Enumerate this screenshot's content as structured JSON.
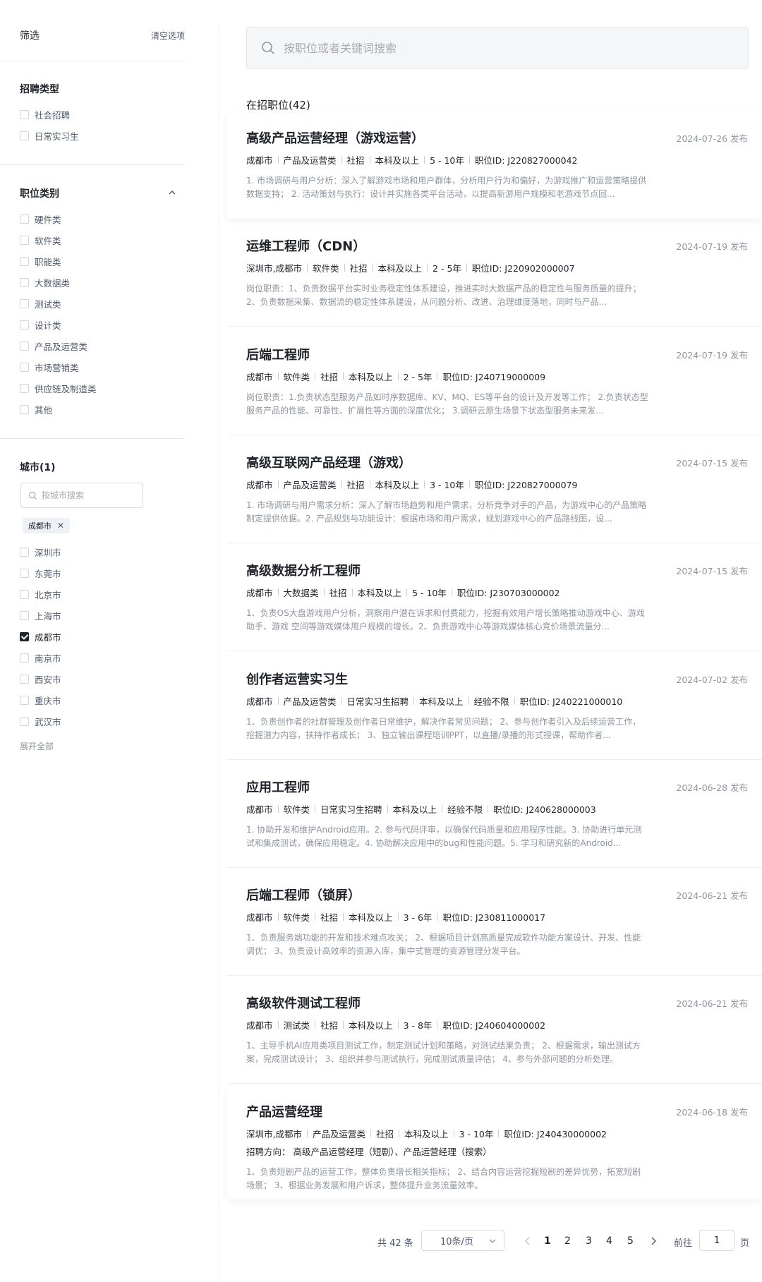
{
  "filter": {
    "title": "筛选",
    "clear": "清空选项"
  },
  "recruit_type": {
    "title": "招聘类型",
    "options": [
      "社会招聘",
      "日常实习生"
    ]
  },
  "job_category": {
    "title": "职位类别",
    "options": [
      "硬件类",
      "软件类",
      "职能类",
      "大数据类",
      "测试类",
      "设计类",
      "产品及运营类",
      "市场营销类",
      "供应链及制造类",
      "其他"
    ]
  },
  "city": {
    "title": "城市(1)",
    "search_placeholder": "按城市搜索",
    "selected_tag": "成都市",
    "options": [
      {
        "label": "深圳市",
        "checked": false
      },
      {
        "label": "东莞市",
        "checked": false
      },
      {
        "label": "北京市",
        "checked": false
      },
      {
        "label": "上海市",
        "checked": false
      },
      {
        "label": "成都市",
        "checked": true
      },
      {
        "label": "南京市",
        "checked": false
      },
      {
        "label": "西安市",
        "checked": false
      },
      {
        "label": "重庆市",
        "checked": false
      },
      {
        "label": "武汉市",
        "checked": false
      }
    ],
    "expand": "展开全部"
  },
  "search": {
    "placeholder": "按职位或者关键词搜索"
  },
  "count_label": "在招职位(42)",
  "jobs": [
    {
      "title": "高级产品运营经理（游戏运营）",
      "date": "2024-07-26 发布",
      "meta": [
        "成都市",
        "产品及运营类",
        "社招",
        "本科及以上",
        "5 - 10年",
        "职位ID:  J220827000042"
      ],
      "direction": "",
      "desc": "1. 市场调研与用户分析：深入了解游戏市场和用户群体，分析用户行为和偏好，为游戏推广和运营策略提供数据支持； 2. 活动策划与执行：设计并实施各类平台活动，以提高新游用户规模和老游戏节点回..."
    },
    {
      "title": "运维工程师（CDN）",
      "date": "2024-07-19 发布",
      "meta": [
        "深圳市,成都市",
        "软件类",
        "社招",
        "本科及以上",
        "2 - 5年",
        "职位ID:  J220902000007"
      ],
      "direction": "",
      "desc": "岗位职责：1、负责数据平台实时业务稳定性体系建设，推进实时大数据产品的稳定性与服务质量的提升； 2、负责数据采集、数据流的稳定性体系建设，从问题分析、改进、治理维度落地，同时与产品..."
    },
    {
      "title": "后端工程师",
      "date": "2024-07-19 发布",
      "meta": [
        "成都市",
        "软件类",
        "社招",
        "本科及以上",
        "2 - 5年",
        "职位ID:  J240719000009"
      ],
      "direction": "",
      "desc": "岗位职责：1.负责状态型服务产品如时序数据库、KV、MQ、ES等平台的设计及开发等工作； 2.负责状态型服务产品的性能、可靠性、扩展性等方面的深度优化； 3.调研云原生场景下状态型服务未来发..."
    },
    {
      "title": "高级互联网产品经理（游戏）",
      "date": "2024-07-15 发布",
      "meta": [
        "成都市",
        "产品及运营类",
        "社招",
        "本科及以上",
        "3 - 10年",
        "职位ID:  J220827000079"
      ],
      "direction": "",
      "desc": "1. 市场调研与用户需求分析：深入了解市场趋势和用户需求，分析竞争对手的产品，为游戏中心的产品策略制定提供依据。2. 产品规划与功能设计：根据市场和用户需求，规划游戏中心的产品路线图，设..."
    },
    {
      "title": "高级数据分析工程师",
      "date": "2024-07-15 发布",
      "meta": [
        "成都市",
        "大数据类",
        "社招",
        "本科及以上",
        "5 - 10年",
        "职位ID:  J230703000002"
      ],
      "direction": "",
      "desc": "1、负责OS大盘游戏用户分析，洞察用户潜在诉求和付费能力，挖掘有效用户增长策略推动游戏中心、游戏助手、游戏 空间等游戏媒体用户规模的增长。2、负责游戏中心等游戏媒体核心竞价场景流量分..."
    },
    {
      "title": "创作者运营实习生",
      "date": "2024-07-02 发布",
      "meta": [
        "成都市",
        "产品及运营类",
        "日常实习生招聘",
        "本科及以上",
        "经验不限",
        "职位ID:  J240221000010"
      ],
      "direction": "",
      "desc": "1、负责创作者的社群管理及创作者日常维护，解决作者常见问题； 2、参与创作者引入及后续运营工作，挖掘潜力内容，扶持作者成长； 3、独立输出课程培训PPT，以直播/录播的形式授课，帮助作者..."
    },
    {
      "title": "应用工程师",
      "date": "2024-06-28 发布",
      "meta": [
        "成都市",
        "软件类",
        "日常实习生招聘",
        "本科及以上",
        "经验不限",
        "职位ID:  J240628000003"
      ],
      "direction": "",
      "desc": "1. 协助开发和维护Android应用。2. 参与代码评审，以确保代码质量和应用程序性能。3. 协助进行单元测试和集成测试，确保应用稳定。4. 协助解决应用中的bug和性能问题。5. 学习和研究新的Android..."
    },
    {
      "title": "后端工程师（锁屏）",
      "date": "2024-06-21 发布",
      "meta": [
        "成都市",
        "软件类",
        "社招",
        "本科及以上",
        "3 - 6年",
        "职位ID:  J230811000017"
      ],
      "direction": "",
      "desc": "1、负责服务端功能的开发和技术难点攻关； 2、根据项目计划高质量完成软件功能方案设计、开发、性能调优； 3、负责设计高效率的资源入库，集中式管理的资源管理分发平台。"
    },
    {
      "title": "高级软件测试工程师",
      "date": "2024-06-21 发布",
      "meta": [
        "成都市",
        "测试类",
        "社招",
        "本科及以上",
        "3 - 8年",
        "职位ID:  J240604000002"
      ],
      "direction": "",
      "desc": "1、主导手机AI应用类项目测试工作，制定测试计划和策略，对测试结果负责； 2、根据需求，输出测试方案，完成测试设计； 3、组织并参与测试执行，完成测试质量评估； 4、参与外部问题的分析处理。"
    },
    {
      "title": "产品运营经理",
      "date": "2024-06-18 发布",
      "meta": [
        "深圳市,成都市",
        "产品及运营类",
        "社招",
        "本科及以上",
        "3 - 10年",
        "职位ID:  J240430000002"
      ],
      "direction": "招聘方向：  高级产品运营经理（短剧）、产品运营经理（搜索）",
      "desc": "1、负责短剧产品的运营工作，整体负责增长相关指标； 2、结合内容运营挖掘短剧的差异优势，拓宽短剧场景； 3、根据业务发展和用户诉求，整体提升业务流量效率。"
    }
  ],
  "pagination": {
    "total": "共 42 条",
    "page_size": "10条/页",
    "pages": [
      "1",
      "2",
      "3",
      "4",
      "5"
    ],
    "current": "1",
    "goto_label": "前往",
    "goto_value": "1",
    "page_unit": "页"
  },
  "colors": {
    "text": "#1f2329",
    "muted": "#8f959e",
    "border": "#d9dbe0"
  }
}
